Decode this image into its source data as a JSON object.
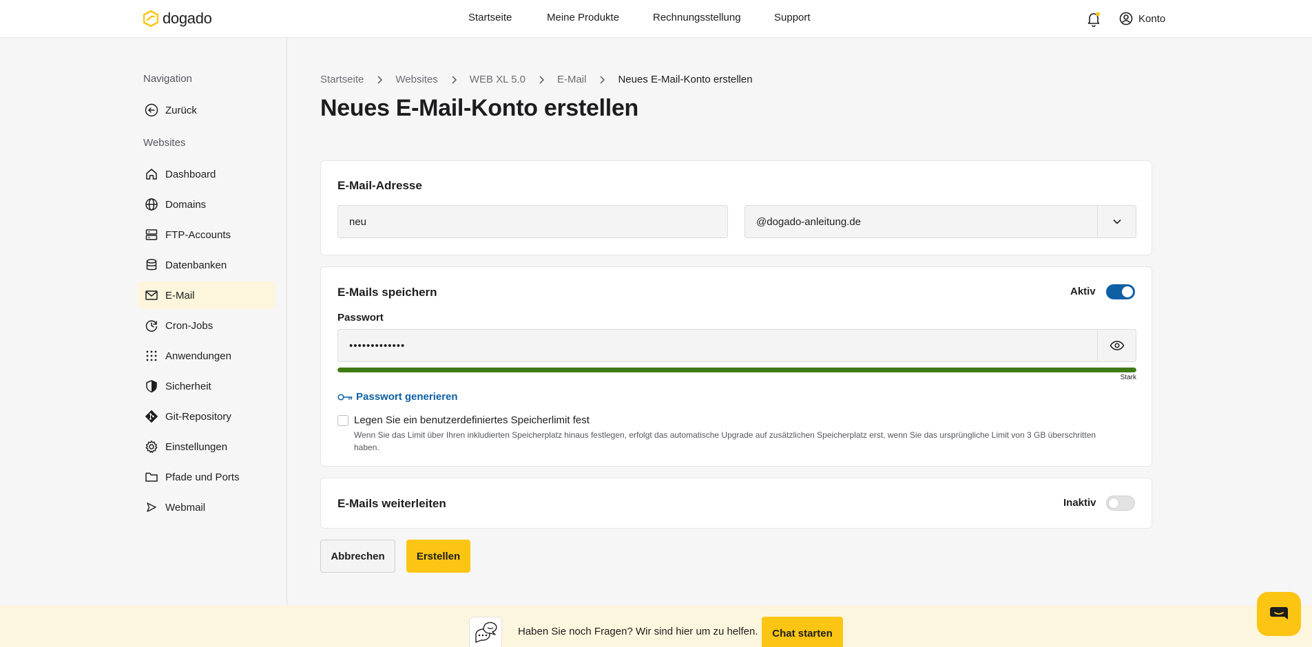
{
  "header": {
    "logo_text": "dogado",
    "nav": [
      "Startseite",
      "Meine Produkte",
      "Rechnungsstellung",
      "Support"
    ],
    "account_label": "Konto"
  },
  "sidebar": {
    "heading_navigation": "Navigation",
    "back_label": "Zurück",
    "heading_websites": "Websites",
    "items": [
      {
        "label": "Dashboard",
        "icon": "home-icon"
      },
      {
        "label": "Domains",
        "icon": "globe-icon"
      },
      {
        "label": "FTP-Accounts",
        "icon": "server-icon"
      },
      {
        "label": "Datenbanken",
        "icon": "database-icon"
      },
      {
        "label": "E-Mail",
        "icon": "mail-icon",
        "active": true
      },
      {
        "label": "Cron-Jobs",
        "icon": "clock-icon"
      },
      {
        "label": "Anwendungen",
        "icon": "grid-icon"
      },
      {
        "label": "Sicherheit",
        "icon": "shield-icon"
      },
      {
        "label": "Git-Repository",
        "icon": "git-icon"
      },
      {
        "label": "Einstellungen",
        "icon": "gear-icon"
      },
      {
        "label": "Pfade und Ports",
        "icon": "folder-icon"
      },
      {
        "label": "Webmail",
        "icon": "send-icon"
      }
    ]
  },
  "breadcrumb": [
    "Startseite",
    "Websites",
    "WEB XL 5.0",
    "E-Mail",
    "Neues E-Mail-Konto erstellen"
  ],
  "page_title": "Neues E-Mail-Konto erstellen",
  "email_card": {
    "title": "E-Mail-Adresse",
    "local_part": "neu",
    "domain": "@dogado-anleitung.de"
  },
  "storage_card": {
    "title": "E-Mails speichern",
    "toggle_label": "Aktiv",
    "toggle_on": true,
    "password_label": "Passwort",
    "password_value": "•••••••••••••",
    "strength_label": "Stark",
    "strength_percent": 100,
    "strength_color": "#3f7a12",
    "generate_label": "Passwort generieren",
    "limit_checkbox_label": "Legen Sie ein benutzerdefiniertes Speicherlimit fest",
    "limit_checked": false,
    "limit_hint": "Wenn Sie das Limit über Ihren inkludierten Speicherplatz hinaus festlegen, erfolgt das automatische Upgrade auf zusätzlichen Speicherplatz erst, wenn Sie das ursprüngliche Limit von 3 GB überschritten haben."
  },
  "forward_card": {
    "title": "E-Mails weiterleiten",
    "toggle_label": "Inaktiv",
    "toggle_on": false
  },
  "actions": {
    "cancel_label": "Abbrechen",
    "create_label": "Erstellen"
  },
  "chat": {
    "text": "Haben Sie noch Fragen? Wir sind hier um zu helfen.",
    "button_label": "Chat starten"
  },
  "colors": {
    "accent": "#fdc513",
    "toggle_on": "#0e5fa3",
    "link": "#0e5fa3"
  }
}
